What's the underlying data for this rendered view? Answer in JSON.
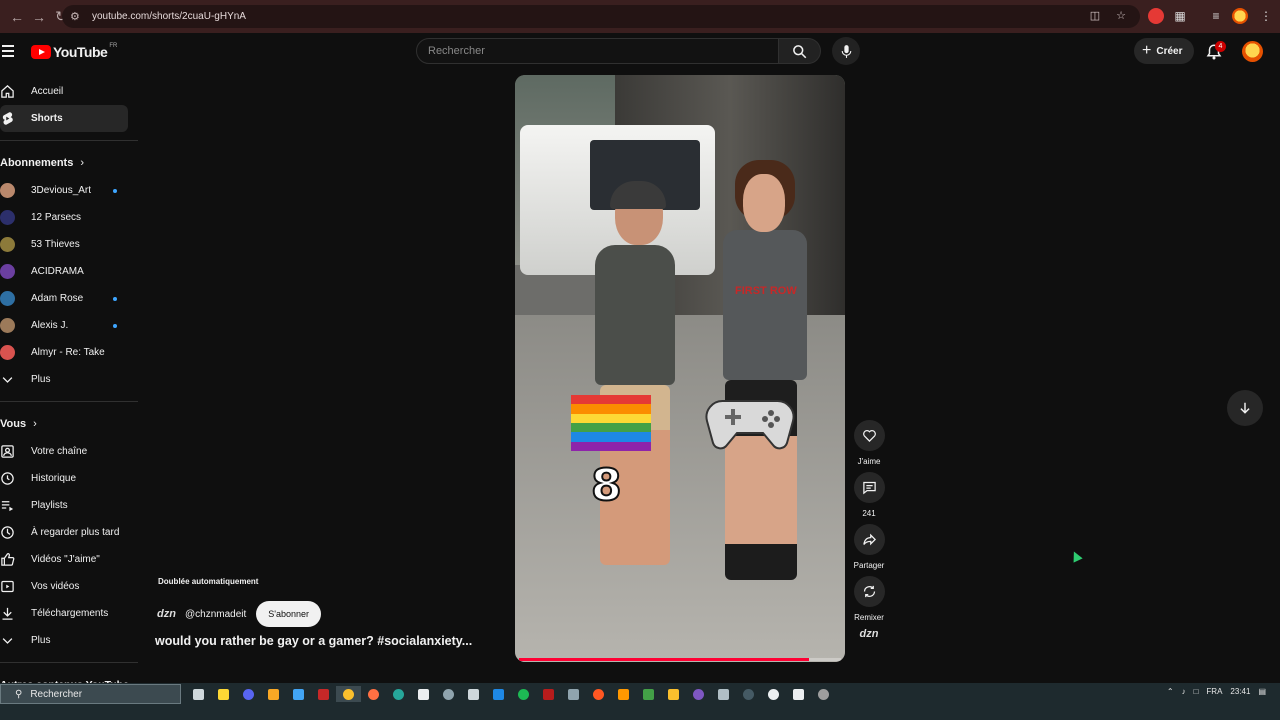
{
  "browser": {
    "url": "youtube.com/shorts/2cuaU-gHYnA"
  },
  "header": {
    "logo_text": "YouTube",
    "region": "FR",
    "search_placeholder": "Rechercher",
    "create_label": "Créer",
    "notification_count": "4"
  },
  "sidebar": {
    "main": [
      {
        "label": "Accueil",
        "icon": "home-icon"
      },
      {
        "label": "Shorts",
        "icon": "shorts-icon",
        "active": true
      }
    ],
    "subscriptions_title": "Abonnements",
    "subscriptions": [
      {
        "label": "3Devious_Art",
        "new": true,
        "color": "#b9886c"
      },
      {
        "label": "12 Parsecs",
        "new": false,
        "color": "#2c2f6b"
      },
      {
        "label": "53 Thieves",
        "new": false,
        "color": "#8c7a3a"
      },
      {
        "label": "ACIDRAMA",
        "new": false,
        "color": "#6b3fa0"
      },
      {
        "label": "Adam Rose",
        "new": true,
        "color": "#2e6fa3"
      },
      {
        "label": "Alexis J.",
        "new": true,
        "color": "#9c7a5a"
      },
      {
        "label": "Almyr - Re: Take",
        "new": false,
        "color": "#d9534f"
      }
    ],
    "more_label": "Plus",
    "you_title": "Vous",
    "you_items": [
      {
        "label": "Votre chaîne",
        "icon": "channel-icon"
      },
      {
        "label": "Historique",
        "icon": "history-icon"
      },
      {
        "label": "Playlists",
        "icon": "playlists-icon"
      },
      {
        "label": "À regarder plus tard",
        "icon": "watch-later-icon"
      },
      {
        "label": "Vidéos \"J'aime\"",
        "icon": "thumbs-up-icon"
      },
      {
        "label": "Vos vidéos",
        "icon": "your-videos-icon"
      },
      {
        "label": "Téléchargements",
        "icon": "download-icon"
      }
    ],
    "more_label_2": "Plus",
    "other_title": "Autres contenus YouTube"
  },
  "short": {
    "dubbed_label": "Doublée automatiquement",
    "channel_logo": "dzn",
    "channel_handle": "@chznmadeit",
    "subscribe_label": "S'abonner",
    "title": "would you rather be gay or a gamer? #socialanxiety...",
    "overlay_number": "8",
    "shirt_print": "FIRST ROW",
    "progress": 0.9,
    "flag_colors": [
      "#e53935",
      "#fb8c00",
      "#fdd835",
      "#43a047",
      "#1e88e5",
      "#8e24aa"
    ]
  },
  "actions": {
    "like_label": "J'aime",
    "comments_count": "241",
    "share_label": "Partager",
    "remix_label": "Remixer",
    "channel_logo": "dzn"
  },
  "taskbar": {
    "search_label": "Rechercher",
    "language": "FRA",
    "time": "23:41"
  },
  "colors": {
    "brand_red": "#ff0000",
    "background": "#0f0f0f",
    "accent_blue": "#3ea6ff"
  }
}
